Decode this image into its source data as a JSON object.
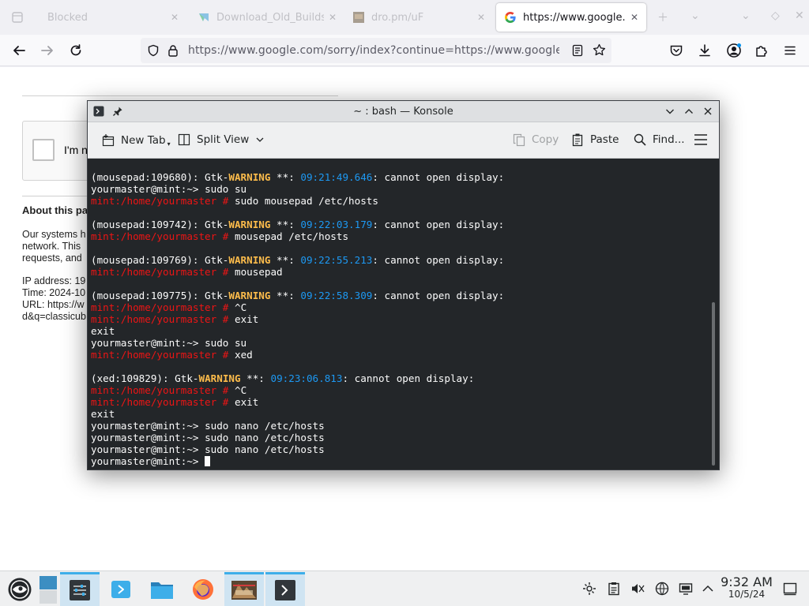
{
  "browser": {
    "tabs": [
      {
        "title": "Blocked",
        "icon": "page-icon",
        "state": "dim"
      },
      {
        "title": "Download_Old_Builds",
        "icon": "site-favicon",
        "state": "dim"
      },
      {
        "title": "dro.pm/uF",
        "icon": "image-thumbnail-icon",
        "state": "dim"
      },
      {
        "title": "https://www.google.co",
        "icon": "google-g-icon",
        "state": "active"
      }
    ],
    "url": "https://www.google.com/sorry/index?continue=https://www.google.com"
  },
  "page": {
    "captcha_label": "I'm n",
    "about_heading": "About this pa",
    "paragraph_lines": [
      "Our systems h",
      "network. This",
      "requests, and"
    ],
    "info_lines": [
      "IP address: 19",
      "Time: 2024-10",
      "URL: https://w",
      "d&q=classicub"
    ]
  },
  "konsole": {
    "title": "~ : bash — Konsole",
    "toolbar": {
      "new_tab": "New Tab",
      "split_view": "Split View",
      "copy": "Copy",
      "paste": "Paste",
      "find": "Find..."
    },
    "prompt_user": "yourmaster@mint:~> ",
    "prompt_root": "mint:/home/yourmaster # ",
    "lines": [
      {
        "kind": "warn",
        "prefix": "(mousepad:109680): Gtk-",
        "time": "09:21:49.646"
      },
      {
        "kind": "user",
        "cmd": "sudo su"
      },
      {
        "kind": "root",
        "cmd": "sudo mousepad /etc/hosts"
      },
      {
        "kind": "blank"
      },
      {
        "kind": "warn",
        "prefix": "(mousepad:109742): Gtk-",
        "time": "09:22:03.179"
      },
      {
        "kind": "root",
        "cmd": "mousepad /etc/hosts"
      },
      {
        "kind": "blank"
      },
      {
        "kind": "warn",
        "prefix": "(mousepad:109769): Gtk-",
        "time": "09:22:55.213"
      },
      {
        "kind": "root",
        "cmd": "mousepad"
      },
      {
        "kind": "blank"
      },
      {
        "kind": "warn",
        "prefix": "(mousepad:109775): Gtk-",
        "time": "09:22:58.309"
      },
      {
        "kind": "root",
        "cmd": "^C"
      },
      {
        "kind": "root",
        "cmd": "exit"
      },
      {
        "kind": "plain",
        "text": "exit"
      },
      {
        "kind": "user",
        "cmd": "sudo su"
      },
      {
        "kind": "root",
        "cmd": "xed"
      },
      {
        "kind": "blank"
      },
      {
        "kind": "warn",
        "prefix": "(xed:109829): Gtk-",
        "time": "09:23:06.813"
      },
      {
        "kind": "root",
        "cmd": "^C"
      },
      {
        "kind": "root",
        "cmd": "exit"
      },
      {
        "kind": "plain",
        "text": "exit"
      },
      {
        "kind": "user",
        "cmd": "sudo nano /etc/hosts"
      },
      {
        "kind": "user",
        "cmd": "sudo nano /etc/hosts"
      },
      {
        "kind": "user",
        "cmd": "sudo nano /etc/hosts"
      },
      {
        "kind": "cursor"
      }
    ],
    "warn_word": "WARNING",
    "warn_mid": " **: ",
    "warn_tail": ": cannot open display:"
  },
  "taskbar": {
    "apps": [
      "application-launcher-icon",
      "desktop-pager-icon",
      "system-settings-icon",
      "discover-icon",
      "dolphin-files-icon",
      "firefox-icon",
      "media-app-icon",
      "konsole-icon"
    ],
    "tray": [
      "kde-connect-icon",
      "clipboard-icon",
      "volume-muted-icon",
      "network-icon",
      "display-icon",
      "tray-expand-icon"
    ],
    "time": "9:32 AM",
    "date": "10/5/24"
  },
  "colors": {
    "terminal_bg": "#232629",
    "warning": "#fdbc4b",
    "timestamp": "#1d99f3",
    "root_prompt": "#ed1515",
    "accent": "#3daee9"
  }
}
